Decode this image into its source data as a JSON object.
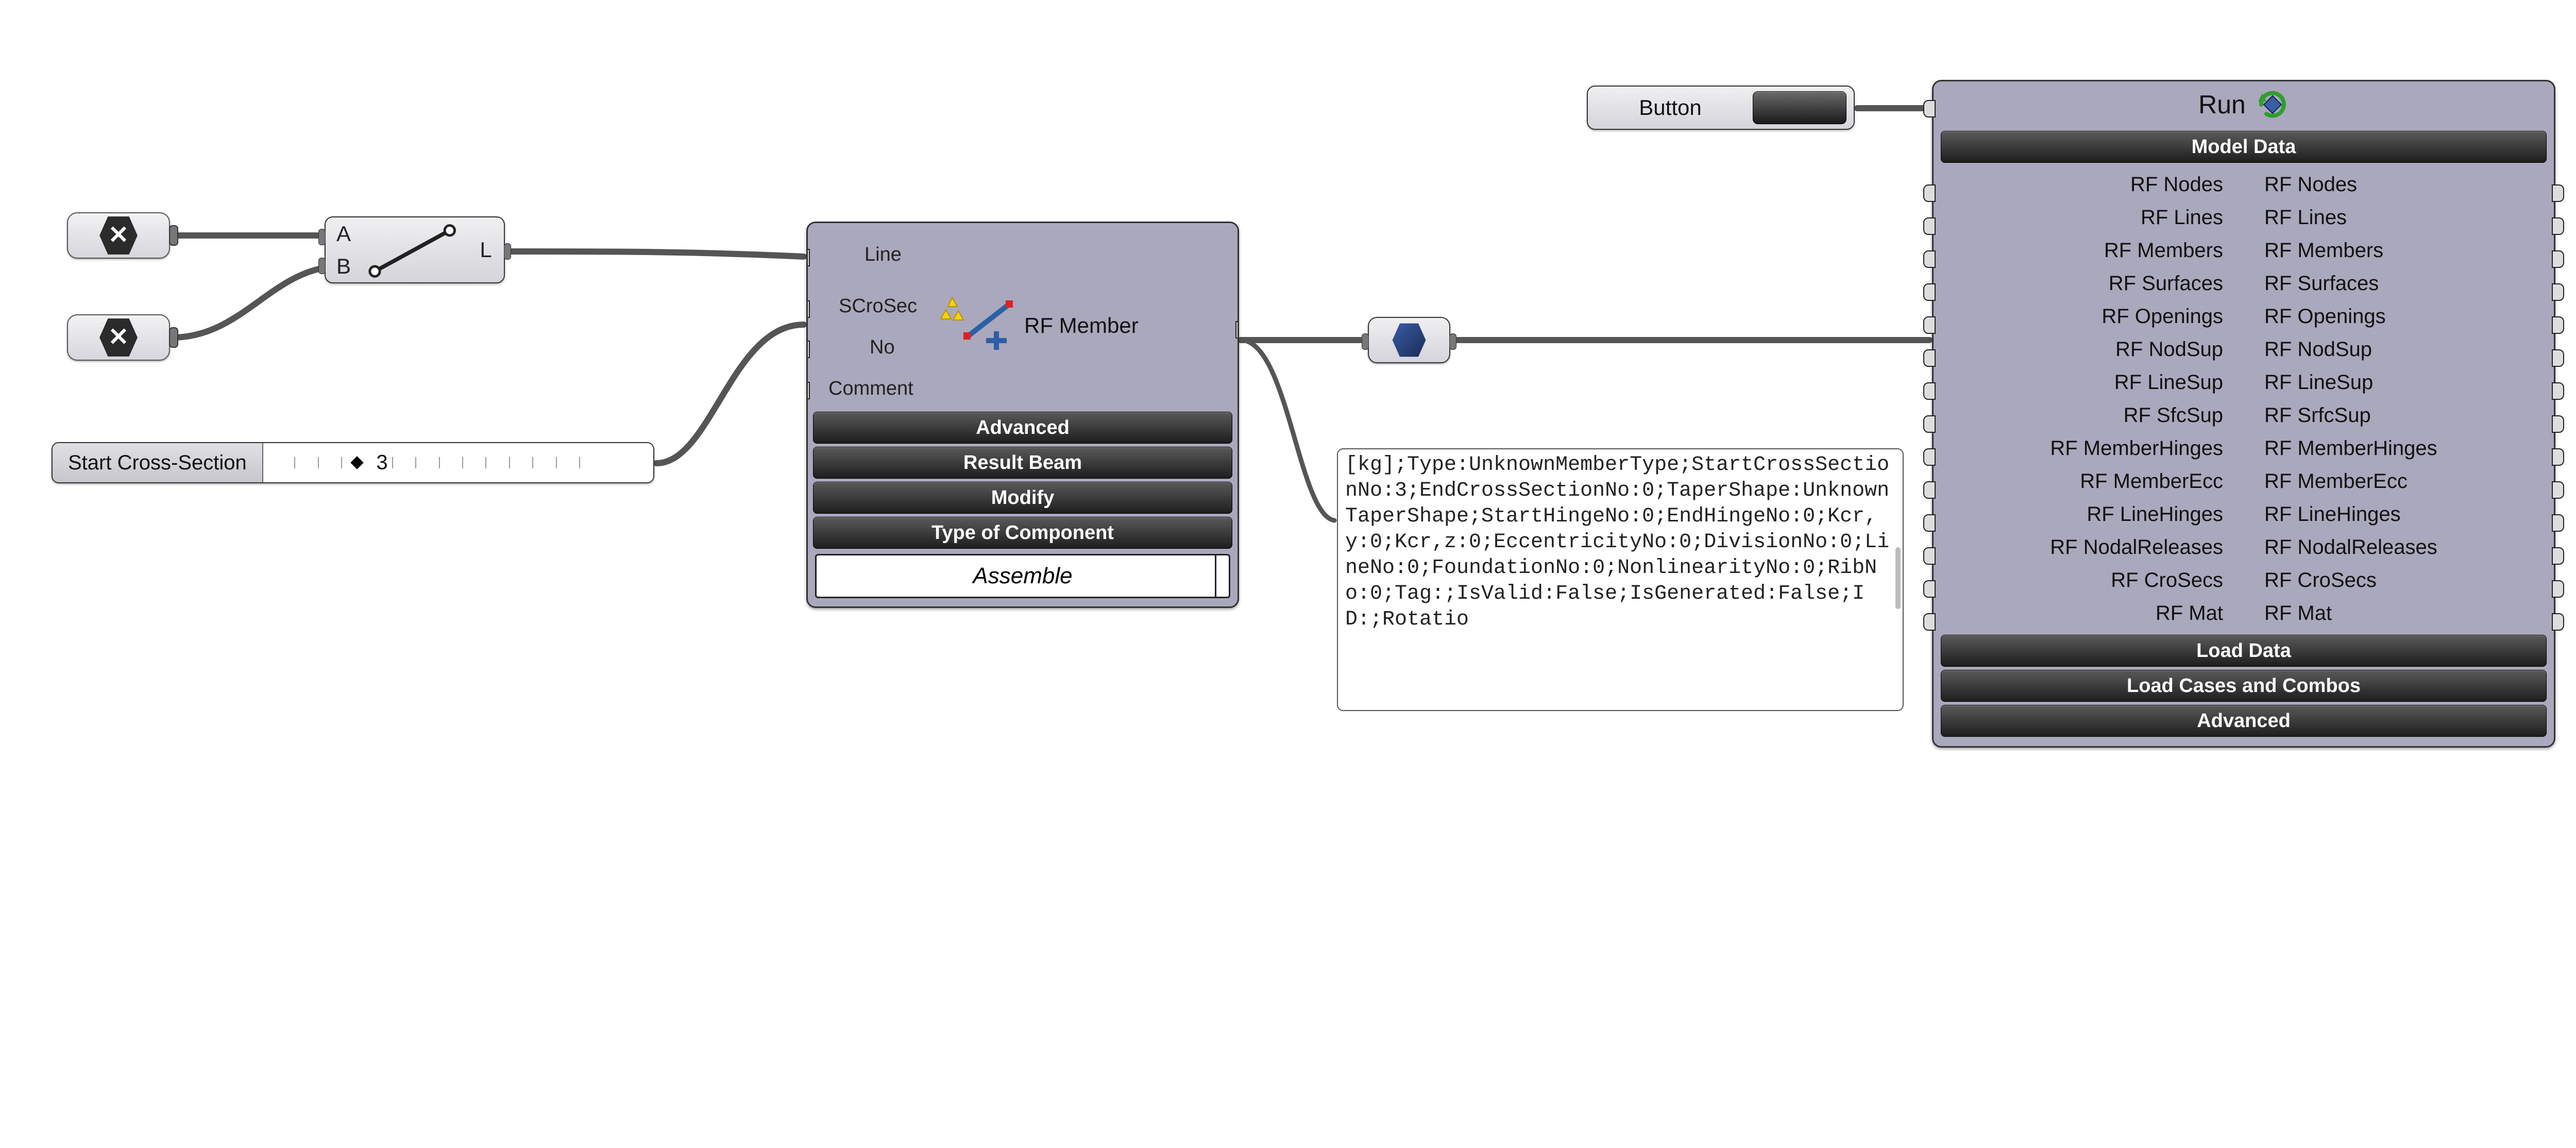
{
  "pill_a": {
    "icon_label": "✕"
  },
  "pill_b": {
    "icon_label": "✕"
  },
  "line_toggle": {
    "in_a": "A",
    "in_b": "B",
    "out": "L"
  },
  "slider": {
    "label": "Start Cross-Section",
    "value": "3"
  },
  "rf_member": {
    "in1": "Line",
    "in2": "SCroSec",
    "in3": "No",
    "in4": "Comment",
    "out": "RF Member",
    "bar1": "Advanced",
    "bar2": "Result Beam",
    "bar3": "Modify",
    "bar4": "Type of Component",
    "assemble": "Assemble"
  },
  "text_panel": {
    "content": "[kg];Type:UnknownMemberType;StartCrossSectionNo:3;EndCrossSectionNo:0;TaperShape:UnknownTaperShape;StartHingeNo:0;EndHingeNo:0;Kcr,y:0;Kcr,z:0;EccentricityNo:0;DivisionNo:0;LineNo:0;FoundationNo:0;NonlinearityNo:0;RibNo:0;Tag:;IsValid:False;IsGenerated:False;ID:;Rotatio"
  },
  "button": {
    "label": "Button"
  },
  "run_panel": {
    "title": "Run",
    "section_model": "Model Data",
    "section_load": "Load Data",
    "section_cases": "Load Cases and Combos",
    "section_adv": "Advanced",
    "rows": [
      "RF Nodes",
      "RF Lines",
      "RF Members",
      "RF Surfaces",
      "RF Openings",
      "RF NodSup",
      "RF LineSup",
      "RF SfcSup",
      "RF MemberHinges",
      "RF MemberEcc",
      "RF LineHinges",
      "RF NodalReleases",
      "RF CroSecs",
      "RF Mat"
    ],
    "rows_right_override": {
      "7": "RF SrfcSup"
    }
  }
}
